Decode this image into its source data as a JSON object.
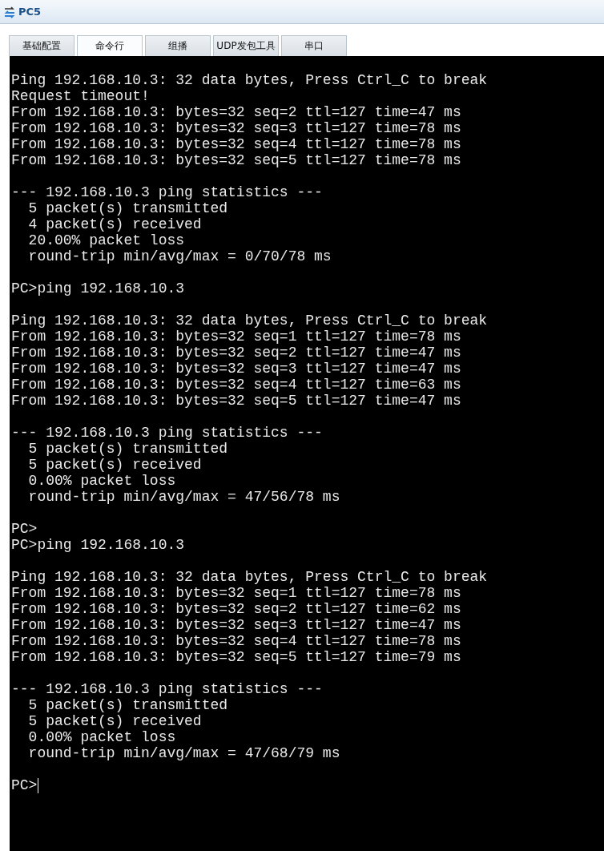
{
  "window": {
    "title": "PC5"
  },
  "tabs": [
    {
      "label": "基础配置",
      "selected": false
    },
    {
      "label": "命令行",
      "selected": true
    },
    {
      "label": "组播",
      "selected": false
    },
    {
      "label": "UDP发包工具",
      "selected": false
    },
    {
      "label": "串口",
      "selected": false
    }
  ],
  "terminal": {
    "blocks": [
      [
        "Ping 192.168.10.3: 32 data bytes, Press Ctrl_C to break",
        "Request timeout!",
        "From 192.168.10.3: bytes=32 seq=2 ttl=127 time=47 ms",
        "From 192.168.10.3: bytes=32 seq=3 ttl=127 time=78 ms",
        "From 192.168.10.3: bytes=32 seq=4 ttl=127 time=78 ms",
        "From 192.168.10.3: bytes=32 seq=5 ttl=127 time=78 ms"
      ],
      [
        "--- 192.168.10.3 ping statistics ---",
        "  5 packet(s) transmitted",
        "  4 packet(s) received",
        "  20.00% packet loss",
        "  round-trip min/avg/max = 0/70/78 ms"
      ],
      [
        "PC>ping 192.168.10.3"
      ],
      [
        "Ping 192.168.10.3: 32 data bytes, Press Ctrl_C to break",
        "From 192.168.10.3: bytes=32 seq=1 ttl=127 time=78 ms",
        "From 192.168.10.3: bytes=32 seq=2 ttl=127 time=47 ms",
        "From 192.168.10.3: bytes=32 seq=3 ttl=127 time=47 ms",
        "From 192.168.10.3: bytes=32 seq=4 ttl=127 time=63 ms",
        "From 192.168.10.3: bytes=32 seq=5 ttl=127 time=47 ms"
      ],
      [
        "--- 192.168.10.3 ping statistics ---",
        "  5 packet(s) transmitted",
        "  5 packet(s) received",
        "  0.00% packet loss",
        "  round-trip min/avg/max = 47/56/78 ms"
      ],
      [
        "PC>",
        "PC>ping 192.168.10.3"
      ],
      [
        "Ping 192.168.10.3: 32 data bytes, Press Ctrl_C to break",
        "From 192.168.10.3: bytes=32 seq=1 ttl=127 time=78 ms",
        "From 192.168.10.3: bytes=32 seq=2 ttl=127 time=62 ms",
        "From 192.168.10.3: bytes=32 seq=3 ttl=127 time=47 ms",
        "From 192.168.10.3: bytes=32 seq=4 ttl=127 time=78 ms",
        "From 192.168.10.3: bytes=32 seq=5 ttl=127 time=79 ms"
      ],
      [
        "--- 192.168.10.3 ping statistics ---",
        "  5 packet(s) transmitted",
        "  5 packet(s) received",
        "  0.00% packet loss",
        "  round-trip min/avg/max = 47/68/79 ms"
      ]
    ],
    "prompt": "PC>"
  }
}
